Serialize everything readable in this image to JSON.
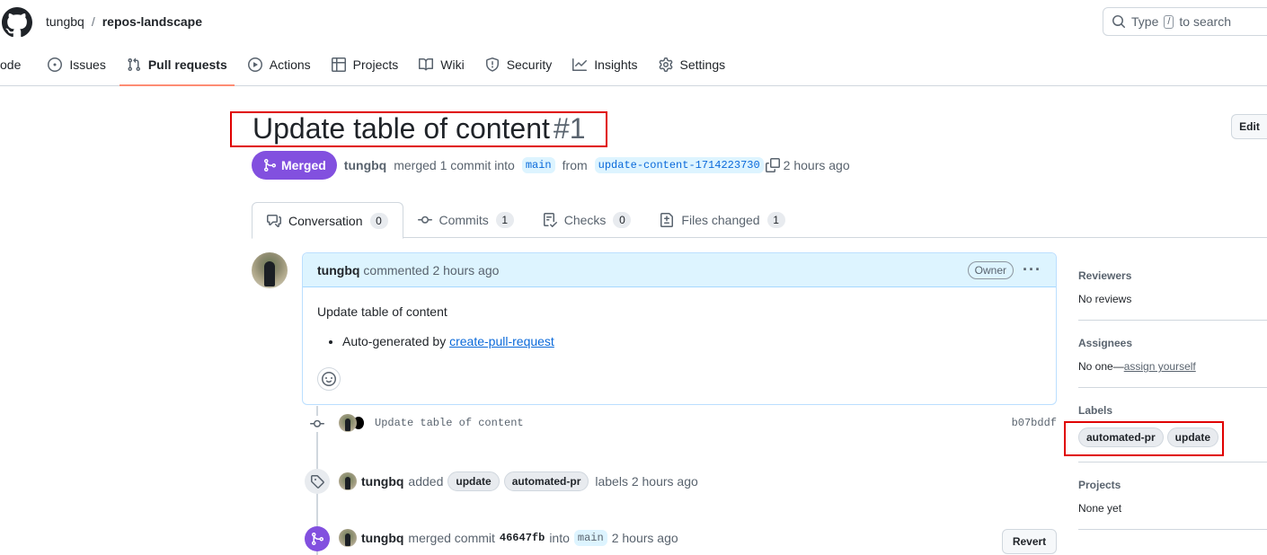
{
  "header": {
    "owner": "tungbq",
    "separator": "/",
    "repo": "repos-landscape",
    "search_prefix": "Type",
    "search_key": "/",
    "search_suffix": "to search"
  },
  "nav": [
    {
      "key": "code",
      "label": "ode"
    },
    {
      "key": "issues",
      "label": "Issues"
    },
    {
      "key": "pulls",
      "label": "Pull requests"
    },
    {
      "key": "actions",
      "label": "Actions"
    },
    {
      "key": "projects",
      "label": "Projects"
    },
    {
      "key": "wiki",
      "label": "Wiki"
    },
    {
      "key": "security",
      "label": "Security"
    },
    {
      "key": "insights",
      "label": "Insights"
    },
    {
      "key": "settings",
      "label": "Settings"
    }
  ],
  "pr": {
    "title": "Update table of content",
    "number": "#1",
    "edit_label": "Edit",
    "state": "Merged",
    "author": "tungbq",
    "summary_mid": "merged 1 commit into",
    "base": "main",
    "from": "from",
    "head": "update-content-1714223730",
    "time": "2 hours ago"
  },
  "tabs": [
    {
      "label": "Conversation",
      "count": "0"
    },
    {
      "label": "Commits",
      "count": "1"
    },
    {
      "label": "Checks",
      "count": "0"
    },
    {
      "label": "Files changed",
      "count": "1"
    }
  ],
  "comment": {
    "author": "tungbq",
    "meta": "commented 2 hours ago",
    "badge": "Owner",
    "body": "Update table of content",
    "bullet_prefix": "Auto-generated by",
    "bullet_link": "create-pull-request"
  },
  "timeline": {
    "commit_message": "Update table of content",
    "commit_sha": "b07bddf",
    "label_event": {
      "author": "tungbq",
      "verb": "added",
      "labels": [
        "update",
        "automated-pr"
      ],
      "suffix": "labels 2 hours ago"
    },
    "merge_event": {
      "author": "tungbq",
      "verb": "merged commit",
      "sha": "46647fb",
      "into": "into",
      "branch": "main",
      "time": "2 hours ago",
      "revert_label": "Revert"
    }
  },
  "sidebar": {
    "reviewers": {
      "title": "Reviewers",
      "value": "No reviews"
    },
    "assignees": {
      "title": "Assignees",
      "value": "No one—",
      "link": "assign yourself"
    },
    "labels": {
      "title": "Labels",
      "items": [
        "automated-pr",
        "update"
      ]
    },
    "projects": {
      "title": "Projects",
      "value": "None yet"
    }
  },
  "colors": {
    "merged": "#8250df",
    "highlight_box": "#e00000",
    "accent_underline": "#fd8c73",
    "link": "#0969da"
  }
}
